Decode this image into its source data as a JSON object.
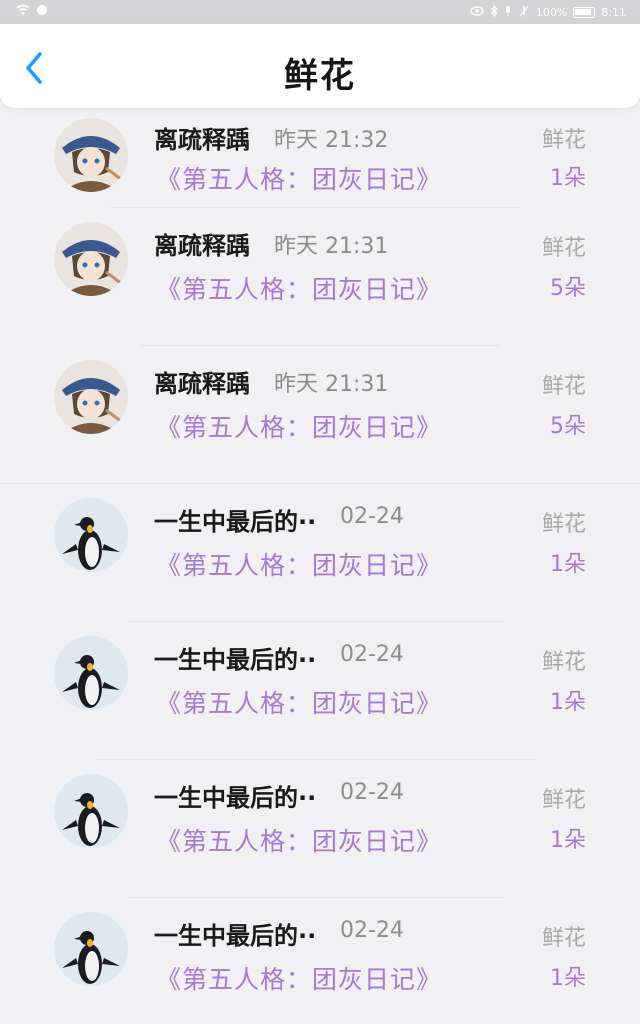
{
  "status_bar": {
    "battery_text": "100%",
    "clock": "8:11"
  },
  "header": {
    "title": "鲜花"
  },
  "gifts": [
    {
      "avatar": "anime-girl-avatar",
      "name": "离疏释踽",
      "time": "昨天 21:32",
      "gift": "《第五人格：团灰日记》",
      "flower": "鲜花",
      "count": "1朵"
    },
    {
      "avatar": "anime-girl-avatar",
      "name": "离疏释踽",
      "time": "昨天 21:31",
      "gift": "《第五人格：团灰日记》",
      "flower": "鲜花",
      "count": "5朵"
    },
    {
      "avatar": "anime-girl-avatar",
      "name": "离疏释踽",
      "time": "昨天 21:31",
      "gift": "《第五人格：团灰日记》",
      "flower": "鲜花",
      "count": "5朵"
    },
    {
      "avatar": "penguin-avatar",
      "name": "一生中最后的··",
      "time": "02-24",
      "gift": "《第五人格：团灰日记》",
      "flower": "鲜花",
      "count": "1朵"
    },
    {
      "avatar": "penguin-avatar",
      "name": "一生中最后的··",
      "time": "02-24",
      "gift": "《第五人格：团灰日记》",
      "flower": "鲜花",
      "count": "1朵"
    },
    {
      "avatar": "penguin-avatar",
      "name": "一生中最后的··",
      "time": "02-24",
      "gift": "《第五人格：团灰日记》",
      "flower": "鲜花",
      "count": "1朵"
    },
    {
      "avatar": "penguin-avatar",
      "name": "一生中最后的··",
      "time": "02-24",
      "gift": "《第五人格：团灰日记》",
      "flower": "鲜花",
      "count": "1朵"
    }
  ],
  "colors": {
    "accent_purple": "#a679d6",
    "back_arrow_blue": "#1e9bff"
  }
}
